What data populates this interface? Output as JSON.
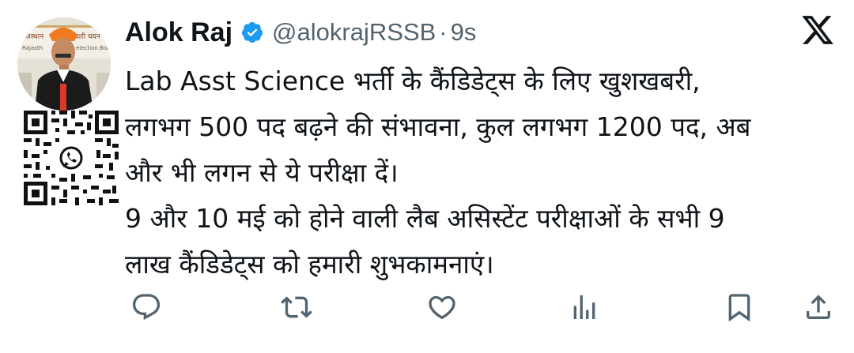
{
  "tweet": {
    "author_name": "Alok Raj",
    "handle": "@alokrajRSSB",
    "separator": "·",
    "time": "9s",
    "lines": [
      "Lab Asst Science भर्ती के कैंडिडेट्स के लिए खुशखबरी,",
      "लगभग 500 पद बढ़ने की संभावना, कुल लगभग 1200 पद,  अब",
      "और भी लगन से ये परीक्षा दें।",
      "9 और 10 मई को होने वाली लैब असिस्टेंट परीक्षाओं के सभी 9",
      "लाख कैंडिडेट्स को हमारी शुभकामनाएं।"
    ]
  },
  "avatar_banner_texts": [
    "राजस्थान",
    "चारी चयन",
    "Rajasth",
    "election Boa"
  ],
  "icons": {
    "verified": "verified-badge-icon",
    "brand": "x-logo-icon",
    "actions": [
      "reply-icon",
      "retweet-icon",
      "like-icon",
      "views-icon",
      "bookmark-icon",
      "share-icon"
    ]
  },
  "colors": {
    "text": "#0f1419",
    "secondary": "#536471",
    "verified": "#1d9bf0"
  }
}
